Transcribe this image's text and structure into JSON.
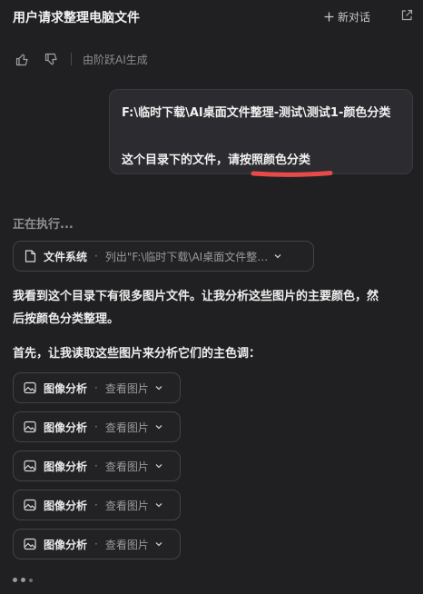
{
  "header": {
    "title": "用户请求整理电脑文件",
    "new_chat_label": "新对话"
  },
  "feedback": {
    "generated_by": "由阶跃AI生成"
  },
  "user_message": {
    "line1": "F:\\临时下载\\AI桌面文件整理-测试\\测试1-颜色分类",
    "line2": "这个目录下的文件，请按照颜色分类",
    "highlight_color": "#e84a4a"
  },
  "assistant": {
    "status": "正在执行...",
    "filesystem_tool": {
      "name": "文件系统",
      "detail": "列出\"F:\\临时下载\\AI桌面文件整…"
    },
    "paragraph1_line1": "我看到这个目录下有很多图片文件。让我分析这些图片的主要颜色，然",
    "paragraph1_line2": "后按颜色分类整理。",
    "paragraph2": "首先，让我读取这些图片来分析它们的主色调：",
    "image_tools": [
      {
        "name": "图像分析",
        "detail": "查看图片"
      },
      {
        "name": "图像分析",
        "detail": "查看图片"
      },
      {
        "name": "图像分析",
        "detail": "查看图片"
      },
      {
        "name": "图像分析",
        "detail": "查看图片"
      },
      {
        "name": "图像分析",
        "detail": "查看图片"
      }
    ],
    "separator": "·"
  },
  "colors": {
    "background": "#202022",
    "bubble": "#2c2c30",
    "pill_border": "#434348"
  }
}
